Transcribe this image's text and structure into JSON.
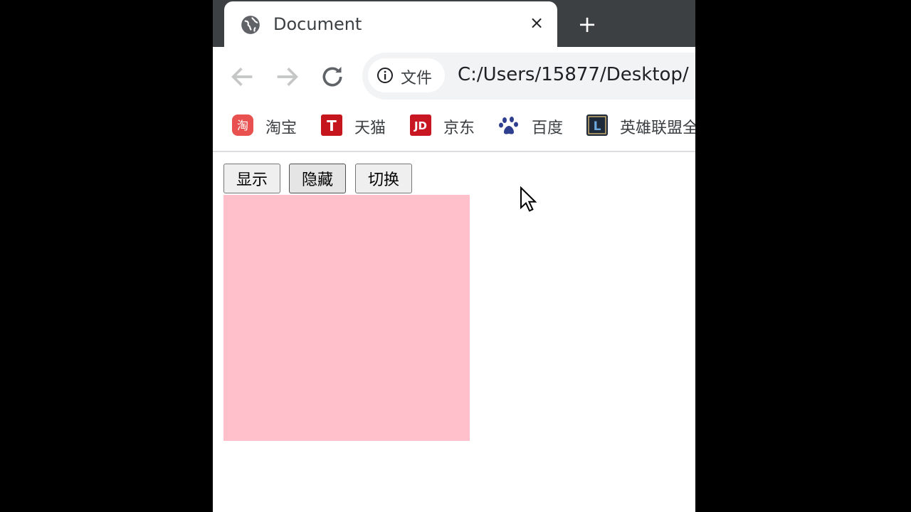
{
  "tab": {
    "title": "Document",
    "close_glyph": "×",
    "new_tab_glyph": "+"
  },
  "omnibox": {
    "chip_label": "文件",
    "url": "C:/Users/15877/Desktop/"
  },
  "bookmarks": [
    {
      "label": "淘宝",
      "icon": "taobao-icon",
      "color": "#e8514f",
      "glyph": "淘"
    },
    {
      "label": "天猫",
      "icon": "tmall-icon",
      "color": "#c4161c",
      "glyph": "T"
    },
    {
      "label": "京东",
      "icon": "jd-icon",
      "color": "#c91623",
      "glyph": "JD"
    },
    {
      "label": "百度",
      "icon": "baidu-paw-icon",
      "color": "#2f3f8f",
      "glyph": ""
    },
    {
      "label": "英雄联盟全",
      "icon": "lol-icon",
      "color": "#1e2a3a",
      "glyph": "L"
    }
  ],
  "buttons": {
    "show": "显示",
    "hide": "隐藏",
    "toggle": "切换"
  },
  "box": {
    "color": "#ffc0cb"
  },
  "colors": {
    "tabstrip": "#3c4043",
    "frame_bg": "#000000"
  }
}
